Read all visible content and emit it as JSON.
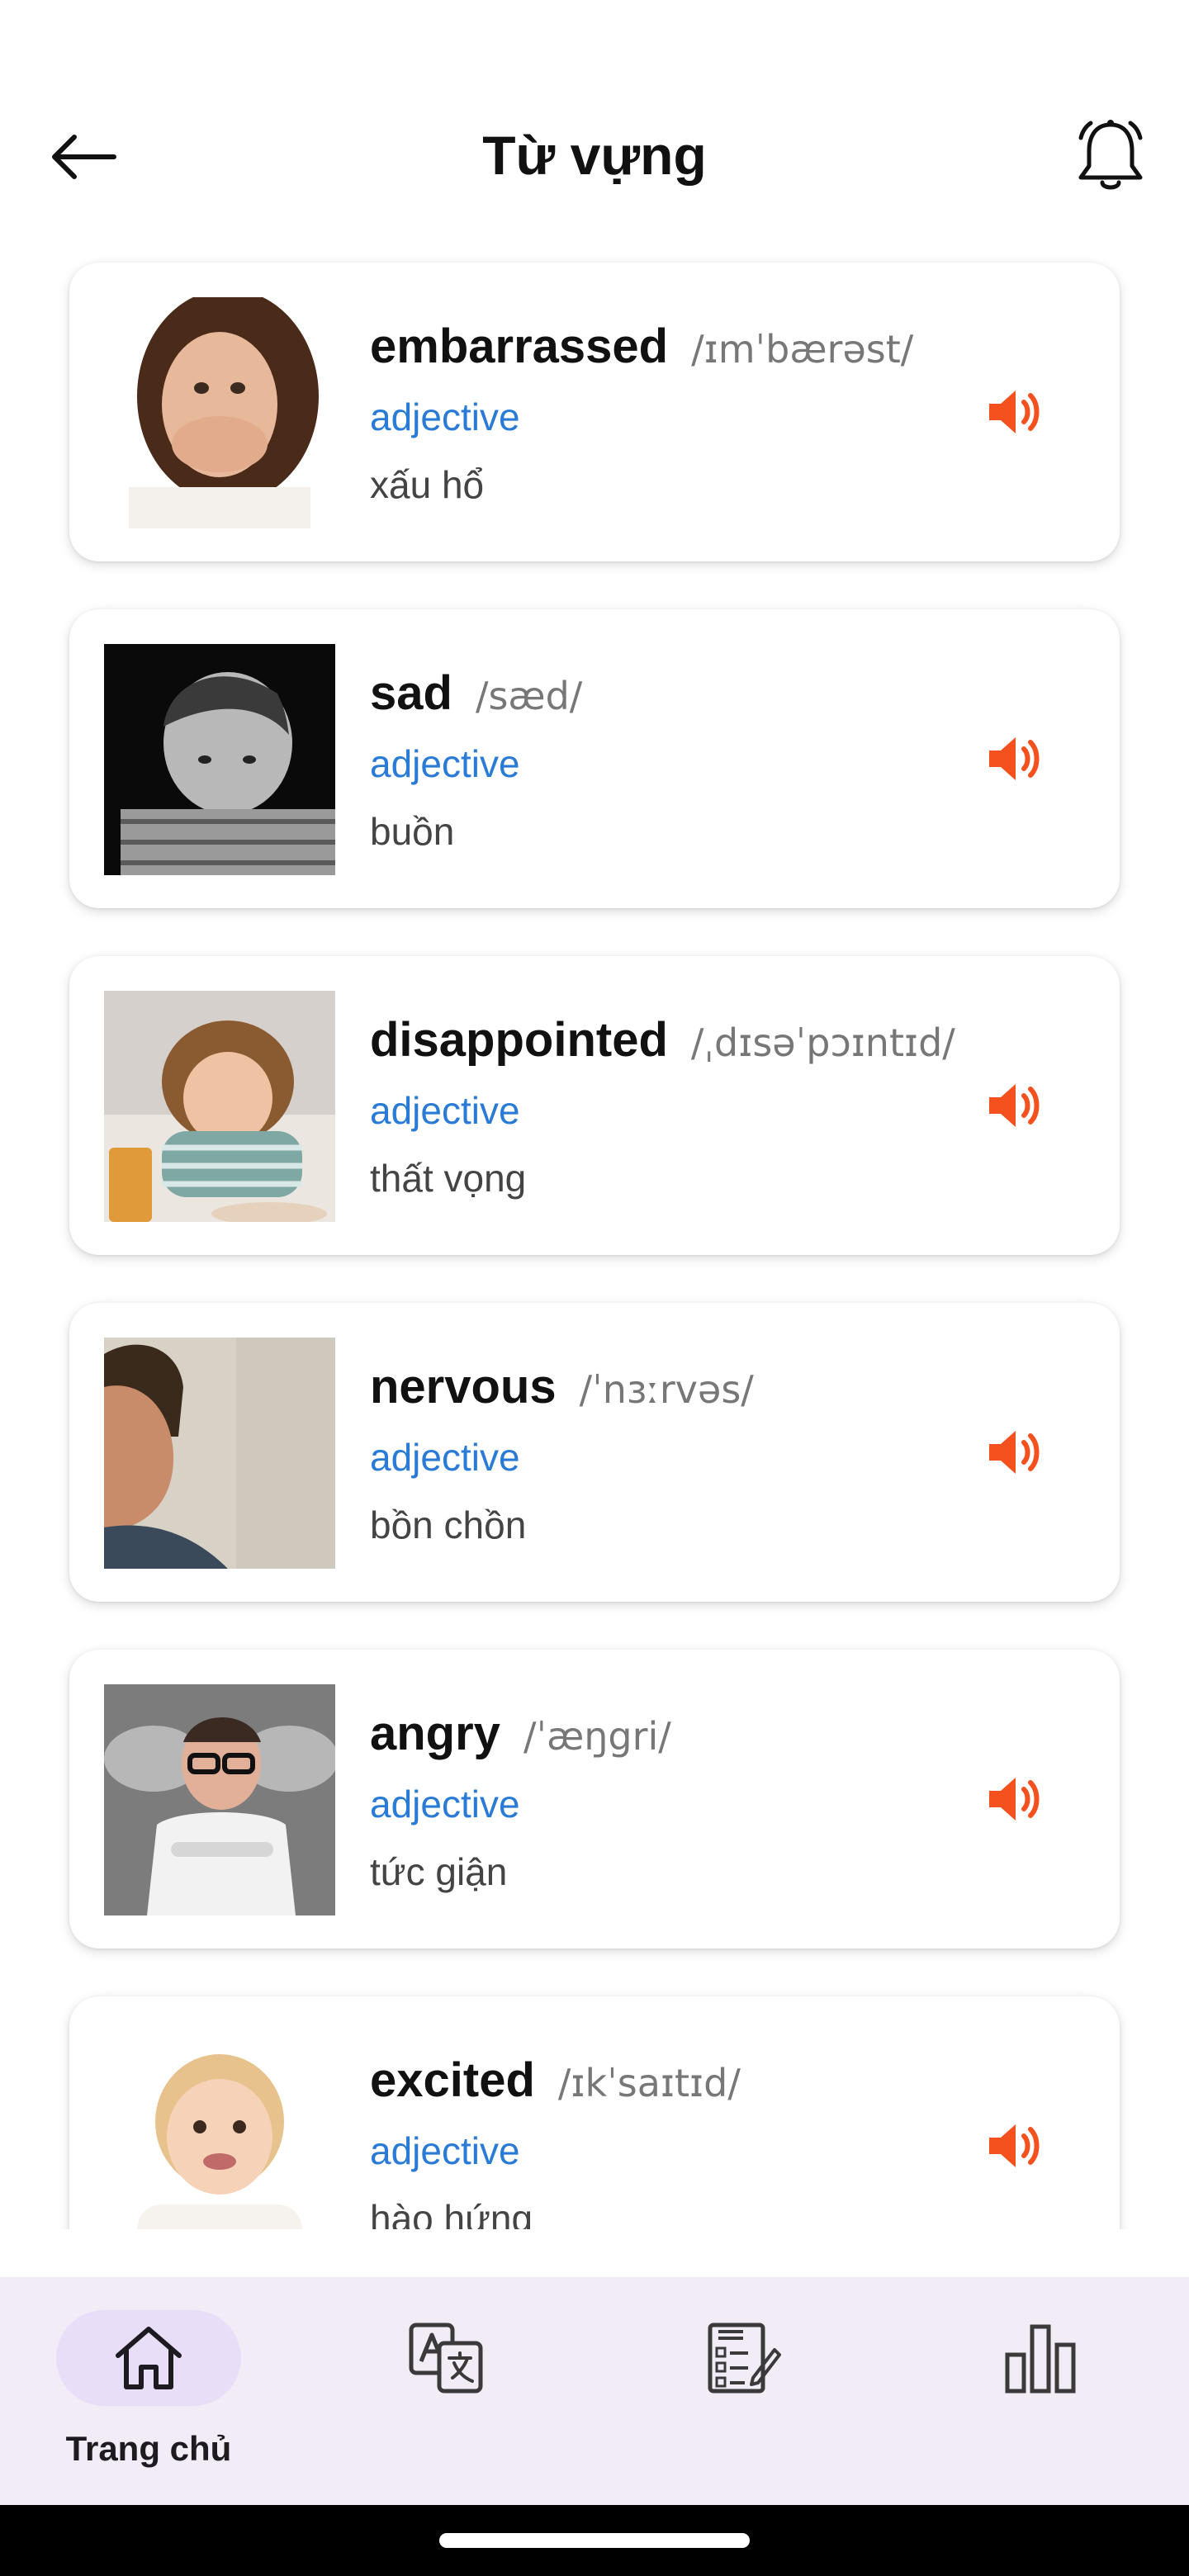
{
  "header": {
    "title": "Từ vựng"
  },
  "words": [
    {
      "word": "embarrassed",
      "ipa": "/ɪmˈbærəst/",
      "pos": "adjective",
      "meaning": "xấu hổ"
    },
    {
      "word": "sad",
      "ipa": "/sæd/",
      "pos": "adjective",
      "meaning": "buồn"
    },
    {
      "word": "disappointed",
      "ipa": "/ˌdɪsəˈpɔɪntɪd/",
      "pos": "adjective",
      "meaning": "thất vọng"
    },
    {
      "word": "nervous",
      "ipa": "/ˈnɜːrvəs/",
      "pos": "adjective",
      "meaning": "bồn chồn"
    },
    {
      "word": "angry",
      "ipa": "/ˈæŋgri/",
      "pos": "adjective",
      "meaning": "tức giận"
    },
    {
      "word": "excited",
      "ipa": "/ɪkˈsaɪtɪd/",
      "pos": "adjective",
      "meaning": "hào hứng"
    }
  ],
  "bottom_nav": {
    "items": [
      {
        "label": "Trang chủ",
        "icon": "home-icon",
        "active": true
      },
      {
        "label": "",
        "icon": "translate-icon",
        "active": false
      },
      {
        "label": "",
        "icon": "test-icon",
        "active": false
      },
      {
        "label": "",
        "icon": "bar-chart-icon",
        "active": false
      }
    ]
  },
  "colors": {
    "accent_speaker": "#f4511e",
    "part_of_speech": "#2a7bd6",
    "nav_background": "#f2ecf6",
    "nav_active_pill": "#e8def8"
  }
}
